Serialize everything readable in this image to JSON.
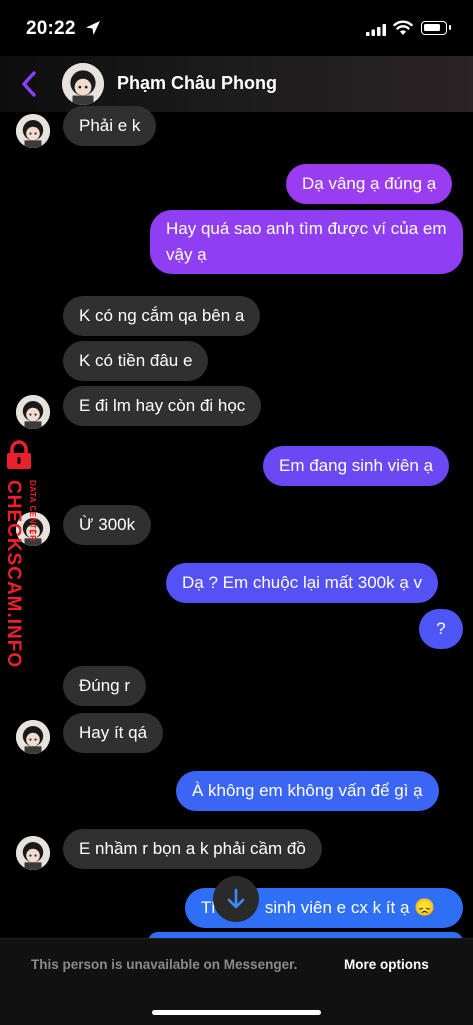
{
  "status": {
    "time": "20:22"
  },
  "contact": {
    "name": "Phạm Châu Phong"
  },
  "messages": [
    {
      "from": "them",
      "text": "Phải e k"
    },
    {
      "from": "me",
      "text": "Dạ vâng ạ đúng ạ"
    },
    {
      "from": "me",
      "text": "Hay quá sao anh tìm được ví của em vậy ạ"
    },
    {
      "from": "them",
      "text": "K có ng cắm qa bên a"
    },
    {
      "from": "them",
      "text": "K có tiền đâu e"
    },
    {
      "from": "them",
      "text": "E đi lm hay còn đi học"
    },
    {
      "from": "me",
      "text": "Em đang sinh viên ạ"
    },
    {
      "from": "them",
      "text": "Ừ 300k"
    },
    {
      "from": "me",
      "text": "Dạ ? Em chuộc lại mất 300k ạ v"
    },
    {
      "from": "me",
      "text": "?"
    },
    {
      "from": "them",
      "text": "Đúng r"
    },
    {
      "from": "them",
      "text": "Hay ít qá"
    },
    {
      "from": "me",
      "text": "À không em không vấn để gì ạ"
    },
    {
      "from": "them",
      "text": "E nhầm r bọn a k phải cầm đồ"
    },
    {
      "from": "me",
      "text_left": "Th",
      "text_right": "sinh viên e cx k ít ạ 😞"
    }
  ],
  "watermark": {
    "main": "CHECKSCAM.INFO",
    "small": "DATA CENTER"
  },
  "footer": {
    "notice": "This person is unavailable on Messenger.",
    "options": "More options"
  },
  "colors": {
    "accent": "#8a3ffc",
    "outgoing_top": "#9a3cf0",
    "outgoing_bottom": "#2f6ff5",
    "incoming": "#303030",
    "watermark": "#e8212d"
  },
  "icons": [
    "location-arrow-icon",
    "signal-icon",
    "wifi-icon",
    "battery-icon",
    "back-chevron-icon",
    "arrow-down-icon",
    "lock-icon"
  ]
}
